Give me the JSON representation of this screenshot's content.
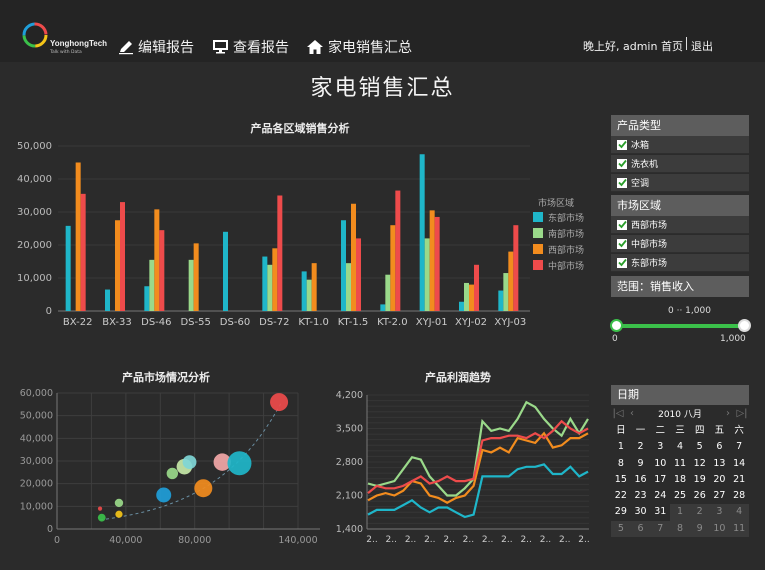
{
  "header": {
    "logo_text": "YonghongTech",
    "logo_sub": "Talk with Data",
    "nav": [
      {
        "label": "编辑报告",
        "icon": "pencil-icon"
      },
      {
        "label": "查看报告",
        "icon": "monitor-icon"
      },
      {
        "label": "家电销售汇总",
        "icon": "home-icon"
      }
    ],
    "greeting": "晚上好, admin",
    "home_link": "首页",
    "logout_link": "退出"
  },
  "page_title": "家电销售汇总",
  "colors": {
    "east": "#1fb6c9",
    "south": "#9ad98a",
    "west": "#f28c1e",
    "central": "#ee4b4b",
    "green": "#3bc04a"
  },
  "chart_data": [
    {
      "type": "bar",
      "title": "产品各区域销售分析",
      "categories": [
        "BX-22",
        "BX-33",
        "DS-46",
        "DS-55",
        "DS-60",
        "DS-72",
        "KT-1.0",
        "KT-1.5",
        "KT-2.0",
        "XYJ-01",
        "XYJ-02",
        "XYJ-03"
      ],
      "series": [
        {
          "name": "东部市场",
          "values": [
            25800,
            6500,
            7500,
            0,
            24000,
            16500,
            12000,
            27500,
            2000,
            47500,
            2800,
            6200
          ]
        },
        {
          "name": "南部市场",
          "values": [
            0,
            0,
            15500,
            15500,
            0,
            14000,
            9500,
            14500,
            11000,
            22000,
            8500,
            11500
          ]
        },
        {
          "name": "西部市场",
          "values": [
            45000,
            27500,
            30800,
            20500,
            0,
            19000,
            14500,
            32500,
            26000,
            30500,
            8000,
            18000
          ]
        },
        {
          "name": "中部市场",
          "values": [
            35500,
            33000,
            24500,
            0,
            0,
            35000,
            0,
            22000,
            36500,
            28500,
            14000,
            26000
          ]
        }
      ],
      "ylim": [
        0,
        50000
      ],
      "yticks": [
        "0",
        "10,000",
        "20,000",
        "30,000",
        "40,000",
        "50,000"
      ],
      "legend_title": "市场区域"
    },
    {
      "type": "scatter",
      "title": "产品市场情况分析",
      "xlim": [
        0,
        140000
      ],
      "ylim": [
        0,
        60000
      ],
      "xticks": [
        "0",
        "40,000",
        "80,000",
        "140,000"
      ],
      "yticks": [
        "0",
        "10,000",
        "20,000",
        "30,000",
        "40,000",
        "50,000",
        "60,000"
      ],
      "points": [
        {
          "x": 25000,
          "y": 9000,
          "r": 0.7,
          "color": "#ee4b4b"
        },
        {
          "x": 26000,
          "y": 5000,
          "r": 1.3,
          "color": "#3bc04a"
        },
        {
          "x": 36000,
          "y": 11500,
          "r": 1.4,
          "color": "#9ad98a"
        },
        {
          "x": 36000,
          "y": 6500,
          "r": 1.2,
          "color": "#f5c518"
        },
        {
          "x": 62000,
          "y": 15000,
          "r": 2.5,
          "color": "#1f9ed9"
        },
        {
          "x": 67000,
          "y": 24500,
          "r": 1.9,
          "color": "#9ad98a"
        },
        {
          "x": 74000,
          "y": 27500,
          "r": 2.6,
          "color": "#c7e8a8"
        },
        {
          "x": 77000,
          "y": 29500,
          "r": 2.3,
          "color": "#7fd6d6"
        },
        {
          "x": 85000,
          "y": 18000,
          "r": 3.0,
          "color": "#f28c1e"
        },
        {
          "x": 96000,
          "y": 29500,
          "r": 2.9,
          "color": "#f3a7a7"
        },
        {
          "x": 106000,
          "y": 29000,
          "r": 4.0,
          "color": "#1fb6c9"
        },
        {
          "x": 129000,
          "y": 56000,
          "r": 3.0,
          "color": "#ee4b4b"
        }
      ],
      "trend": true
    },
    {
      "type": "line",
      "title": "产品利润趋势",
      "ylim": [
        1400,
        4200
      ],
      "yticks": [
        "1,400",
        "2,100",
        "2,800",
        "3,500",
        "4,200"
      ],
      "x_tick_labels": [
        "2..",
        "2..",
        "2..",
        "2..",
        "2..",
        "2..",
        "2..",
        "2..",
        "2..",
        "2..",
        "2..",
        "2.."
      ],
      "series": [
        {
          "name": "东部市场",
          "values": [
            1700,
            1800,
            1800,
            1800,
            1900,
            2000,
            1850,
            1750,
            1850,
            1850,
            1750,
            1650,
            1700,
            2500,
            2500,
            2500,
            2500,
            2650,
            2700,
            2700,
            2750,
            2550,
            2550,
            2700,
            2500,
            2600
          ]
        },
        {
          "name": "南部市场",
          "values": [
            2350,
            2300,
            2350,
            2400,
            2650,
            2900,
            2850,
            2500,
            2300,
            2100,
            2100,
            2250,
            2450,
            3650,
            3450,
            3500,
            3450,
            3700,
            4050,
            3950,
            3700,
            3500,
            3350,
            3700,
            3400,
            3700
          ]
        },
        {
          "name": "西部市场",
          "values": [
            2000,
            2100,
            2150,
            2100,
            2200,
            2400,
            2350,
            2100,
            2050,
            1950,
            2050,
            2100,
            2300,
            3050,
            3000,
            3100,
            3000,
            3300,
            3250,
            3200,
            3400,
            3100,
            3150,
            3300,
            3300,
            3400
          ]
        },
        {
          "name": "中部市场",
          "values": [
            2150,
            2300,
            2250,
            2250,
            2300,
            2400,
            2500,
            2350,
            2400,
            2500,
            2400,
            2400,
            2450,
            3250,
            3300,
            3300,
            3350,
            3350,
            3300,
            3400,
            3300,
            3450,
            3650,
            3500,
            3400,
            3500
          ]
        }
      ]
    }
  ],
  "legend": [
    "东部市场",
    "南部市场",
    "西部市场",
    "中部市场"
  ],
  "filters": {
    "product_type_title": "产品类型",
    "product_types": [
      "冰箱",
      "洗衣机",
      "空调"
    ],
    "region_title": "市场区域",
    "regions": [
      "西部市场",
      "中部市场",
      "东部市场"
    ],
    "range_label": "范围：销售收入",
    "range_values": "0 ·· 1,000",
    "range_min": "0",
    "range_max": "1,000",
    "range_fraction": [
      0.0,
      1.0
    ]
  },
  "calendar": {
    "title": "日期",
    "year": "2010",
    "month": "八月",
    "weekdays": [
      "日",
      "一",
      "二",
      "三",
      "四",
      "五",
      "六"
    ],
    "days": [
      {
        "d": "1",
        "o": false
      },
      {
        "d": "2",
        "o": false
      },
      {
        "d": "3",
        "o": false
      },
      {
        "d": "4",
        "o": false
      },
      {
        "d": "5",
        "o": false
      },
      {
        "d": "6",
        "o": false
      },
      {
        "d": "7",
        "o": false
      },
      {
        "d": "8",
        "o": false
      },
      {
        "d": "9",
        "o": false
      },
      {
        "d": "10",
        "o": false
      },
      {
        "d": "11",
        "o": false
      },
      {
        "d": "12",
        "o": false
      },
      {
        "d": "13",
        "o": false
      },
      {
        "d": "14",
        "o": false
      },
      {
        "d": "15",
        "o": false
      },
      {
        "d": "16",
        "o": false
      },
      {
        "d": "17",
        "o": false
      },
      {
        "d": "18",
        "o": false
      },
      {
        "d": "19",
        "o": false
      },
      {
        "d": "20",
        "o": false
      },
      {
        "d": "21",
        "o": false
      },
      {
        "d": "22",
        "o": false
      },
      {
        "d": "23",
        "o": false
      },
      {
        "d": "24",
        "o": false
      },
      {
        "d": "25",
        "o": false
      },
      {
        "d": "26",
        "o": false
      },
      {
        "d": "27",
        "o": false
      },
      {
        "d": "28",
        "o": false
      },
      {
        "d": "29",
        "o": false
      },
      {
        "d": "30",
        "o": false
      },
      {
        "d": "31",
        "o": false
      },
      {
        "d": "1",
        "o": true
      },
      {
        "d": "2",
        "o": true
      },
      {
        "d": "3",
        "o": true
      },
      {
        "d": "4",
        "o": true
      },
      {
        "d": "5",
        "o": true
      },
      {
        "d": "6",
        "o": true
      },
      {
        "d": "7",
        "o": true
      },
      {
        "d": "8",
        "o": true
      },
      {
        "d": "9",
        "o": true
      },
      {
        "d": "10",
        "o": true
      },
      {
        "d": "11",
        "o": true
      }
    ]
  }
}
